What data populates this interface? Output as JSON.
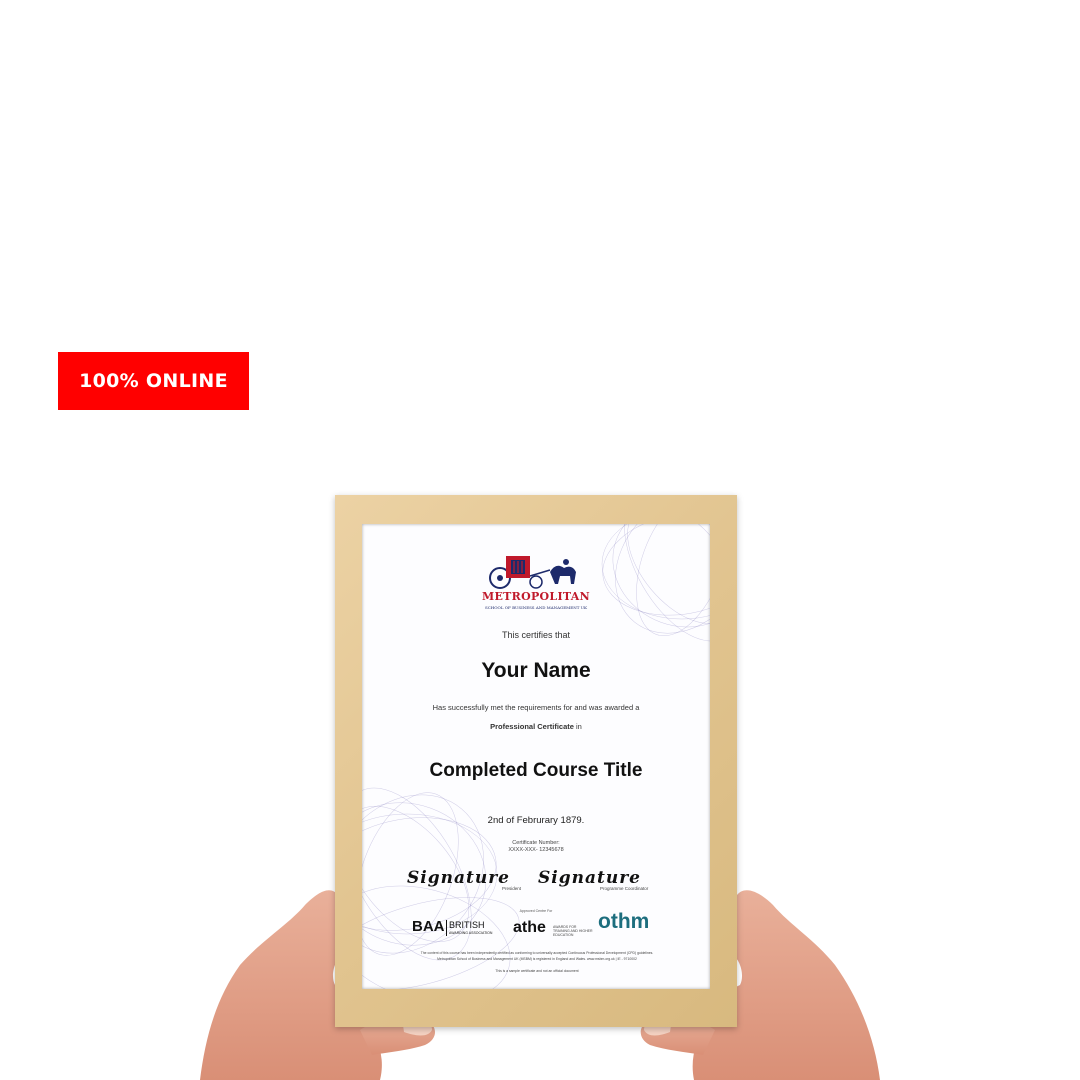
{
  "badge": {
    "label": "100% ONLINE",
    "color": "#ff0000"
  },
  "certificate": {
    "logo": {
      "name": "METROPOLITAN",
      "subtitle": "SCHOOL OF BUSINESS AND MANAGEMENT UK"
    },
    "certifies": "This certifies that",
    "recipient": "Your Name",
    "statement": "Has successfully met the requirements for and was awarded a",
    "award_bold": "Professional Certificate",
    "award_suffix": " in",
    "course": "Completed Course Title",
    "date": "2nd of Februrary 1879.",
    "cert_number_label": "Certificate Number:",
    "cert_number": "XXXX-XXX- 12345678",
    "signatures": [
      {
        "text": "Signature",
        "role": "President"
      },
      {
        "text": "Signature",
        "role": "Programme Coordinator"
      }
    ],
    "approved_label": "Approved Centre For",
    "partners": {
      "baa": "BAA",
      "baa_name": "BRITISH",
      "baa_sub": "AWARDING ASSOCIATION",
      "athe": "athe",
      "athe_sub": "AWARDS FOR TRAINING AND HIGHER EDUCATION",
      "othm": "othm"
    },
    "footer_1": "The content of this course has been independently certified as conforming to universally accepted Continuous Professional Development (CPD) guidelines.",
    "footer_2": "Metropolitan School of Business and Management UK (MSBM) is registered in England and Wales. www.msbm.org.uk  |  IE - 9710002",
    "footer_3": "This is a sample certificate and not an official document"
  },
  "colors": {
    "frame_wood": "#e2c591",
    "logo_red": "#c0192b",
    "logo_navy": "#1d2a6b",
    "othm_teal": "#1d6e7e"
  }
}
